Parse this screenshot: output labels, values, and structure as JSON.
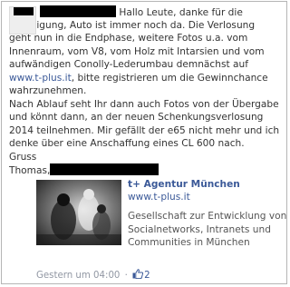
{
  "post": {
    "lines": [
      "Hallo Leute, danke für die",
      "Beteiligung, Auto ist immer noch da. Die Verlosung",
      "geht nun in die Endphase, weitere Fotos u.a. vom",
      "Innenraum, vom V8, vom Holz mit Intarsien und vom",
      "aufwändigen Conolly-Lederumbau demnächst auf"
    ],
    "link_text": "www.t-plus.it",
    "line_after_link": ", bitte registrieren um die Gewinnchance",
    "lines2": [
      "wahrzunehmen.",
      "Nach Ablauf seht Ihr dann auch Fotos von der Übergabe",
      "und könnt dann, an der neuen Schenkungsverlosung",
      "2014 teilnehmen. Mir gefällt der e65 nicht mehr und ich",
      "denke über eine Anschaffung eines CL 600 nach.",
      "Gruss"
    ],
    "signature": "Thomas,"
  },
  "attachment": {
    "title": "t+ Agentur München",
    "url": "www.t-plus.it",
    "description": [
      "Gesellschaft zur Entwicklung von",
      "Socialnetworks, Intranets und",
      "Communities in München"
    ]
  },
  "footer": {
    "timestamp": "Gestern um 04:00",
    "separator": "·",
    "like_count": "2"
  },
  "colors": {
    "link": "#3b5998",
    "muted": "#9197a3"
  }
}
